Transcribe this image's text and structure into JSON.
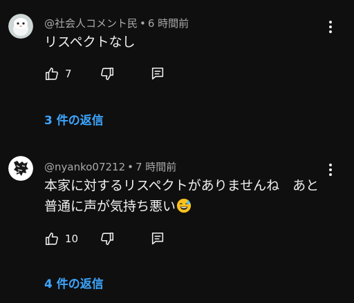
{
  "comments": [
    {
      "author": "@社会人コメント民",
      "separator": "•",
      "time": "6 時間前",
      "lines": [
        "リスペクトなし"
      ],
      "likes": "7",
      "replies": "3 件の返信"
    },
    {
      "author": "@nyanko07212",
      "separator": "•",
      "time": "7 時間前",
      "lines": [
        "本家に対するリスペクトがありませんね　あと",
        "普通に声が気持ち悪い"
      ],
      "likes": "10",
      "replies": "4 件の返信"
    }
  ],
  "icons": {
    "like": "thumb-up-icon",
    "dislike": "thumb-down-icon",
    "reply": "reply-comment-icon",
    "more": "more-vert-icon",
    "emoji": "sweat-smile-emoji"
  },
  "colors": {
    "background": "#0f0f0f",
    "text": "#f1f1f1",
    "meta": "#aaaaaa",
    "link": "#3ea6ff"
  }
}
